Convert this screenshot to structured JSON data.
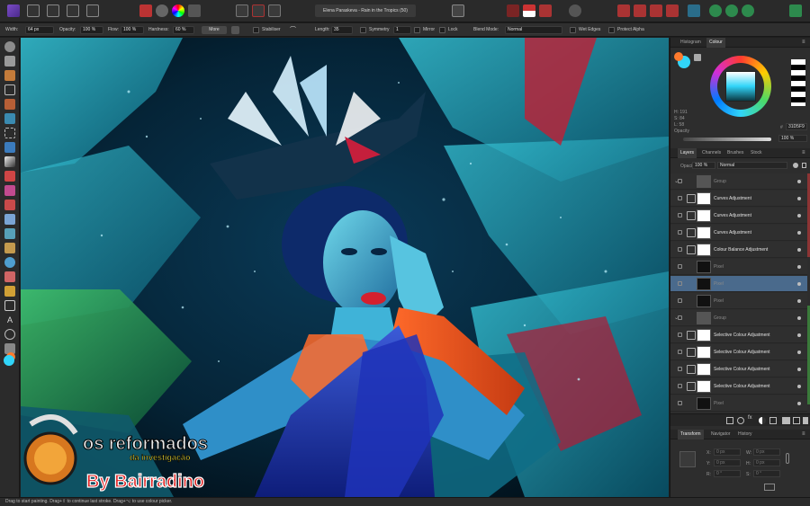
{
  "document": {
    "title": "Elena Paraskeva - Rain in the Tropics (50)"
  },
  "context_toolbar": {
    "width_label": "Width:",
    "width_value": "64 px",
    "opacity_label": "Opacity:",
    "opacity_value": "100 %",
    "flow_label": "Flow:",
    "flow_value": "100 %",
    "hardness_label": "Hardness:",
    "hardness_value": "60 %",
    "more_label": "More",
    "stabiliser_label": "Stabiliser",
    "length_label": "Length:",
    "length_value": "35",
    "symmetry_label": "Symmetry",
    "symmetry_value": "1",
    "mirror_label": "Mirror",
    "lock_label": "Lock",
    "blend_mode_label": "Blend Mode:",
    "blend_mode_value": "Normal",
    "wet_edges_label": "Wet Edges",
    "protect_alpha_label": "Protect Alpha"
  },
  "colour_panel": {
    "tabs": [
      "Histogram",
      "Colour"
    ],
    "active_tab": "Colour",
    "h_label": "H: 191",
    "s_label": "S: 84",
    "l_label": "L: 58",
    "hex_label": "#",
    "hex_value": "31D5F9",
    "opacity_label": "Opacity",
    "opacity_value": "100 %",
    "current_colour": "#31D5F9"
  },
  "layers_panel": {
    "tabs": [
      "Layers",
      "Channels",
      "Brushes",
      "Stock"
    ],
    "active_tab": "Layers",
    "opacity_label": "Opacity:",
    "opacity_value": "100 %",
    "blend_value": "Normal",
    "rows": [
      {
        "name": "Group",
        "dim": true
      },
      {
        "name": "Curves Adjustment",
        "dim": false
      },
      {
        "name": "Curves Adjustment",
        "dim": false
      },
      {
        "name": "Curves Adjustment",
        "dim": false
      },
      {
        "name": "Colour Balance Adjustment",
        "dim": false
      },
      {
        "name": "Pixel",
        "dim": true
      },
      {
        "name": "Pixel",
        "dim": true
      },
      {
        "name": "Pixel",
        "dim": true
      },
      {
        "name": "Group",
        "dim": true
      },
      {
        "name": "Selective Colour Adjustment",
        "dim": false
      },
      {
        "name": "Selective Colour Adjustment",
        "dim": false
      },
      {
        "name": "Selective Colour Adjustment",
        "dim": false
      },
      {
        "name": "Selective Colour Adjustment",
        "dim": false
      },
      {
        "name": "Pixel",
        "dim": true
      }
    ]
  },
  "transform_panel": {
    "tabs": [
      "Transform",
      "Navigator",
      "History"
    ],
    "active_tab": "Transform",
    "x_label": "X:",
    "x_value": "0 px",
    "y_label": "Y:",
    "y_value": "0 px",
    "w_label": "W:",
    "w_value": "0 px",
    "h_label": "H:",
    "h_value": "0 px",
    "r_label": "R:",
    "r_value": "0 °",
    "s_label": "S:",
    "s_value": "0 °"
  },
  "status_bar": {
    "text": "Drag to start painting. Drag+⇧ to continue last stroke. Drag+⌥ to use colour picker."
  },
  "watermark": {
    "line1": "os reformados",
    "line2": "da investigação",
    "line3": "By Bairradino"
  },
  "colors": {
    "accent": "#4a6a8c",
    "cyan": "#31D5F9"
  }
}
